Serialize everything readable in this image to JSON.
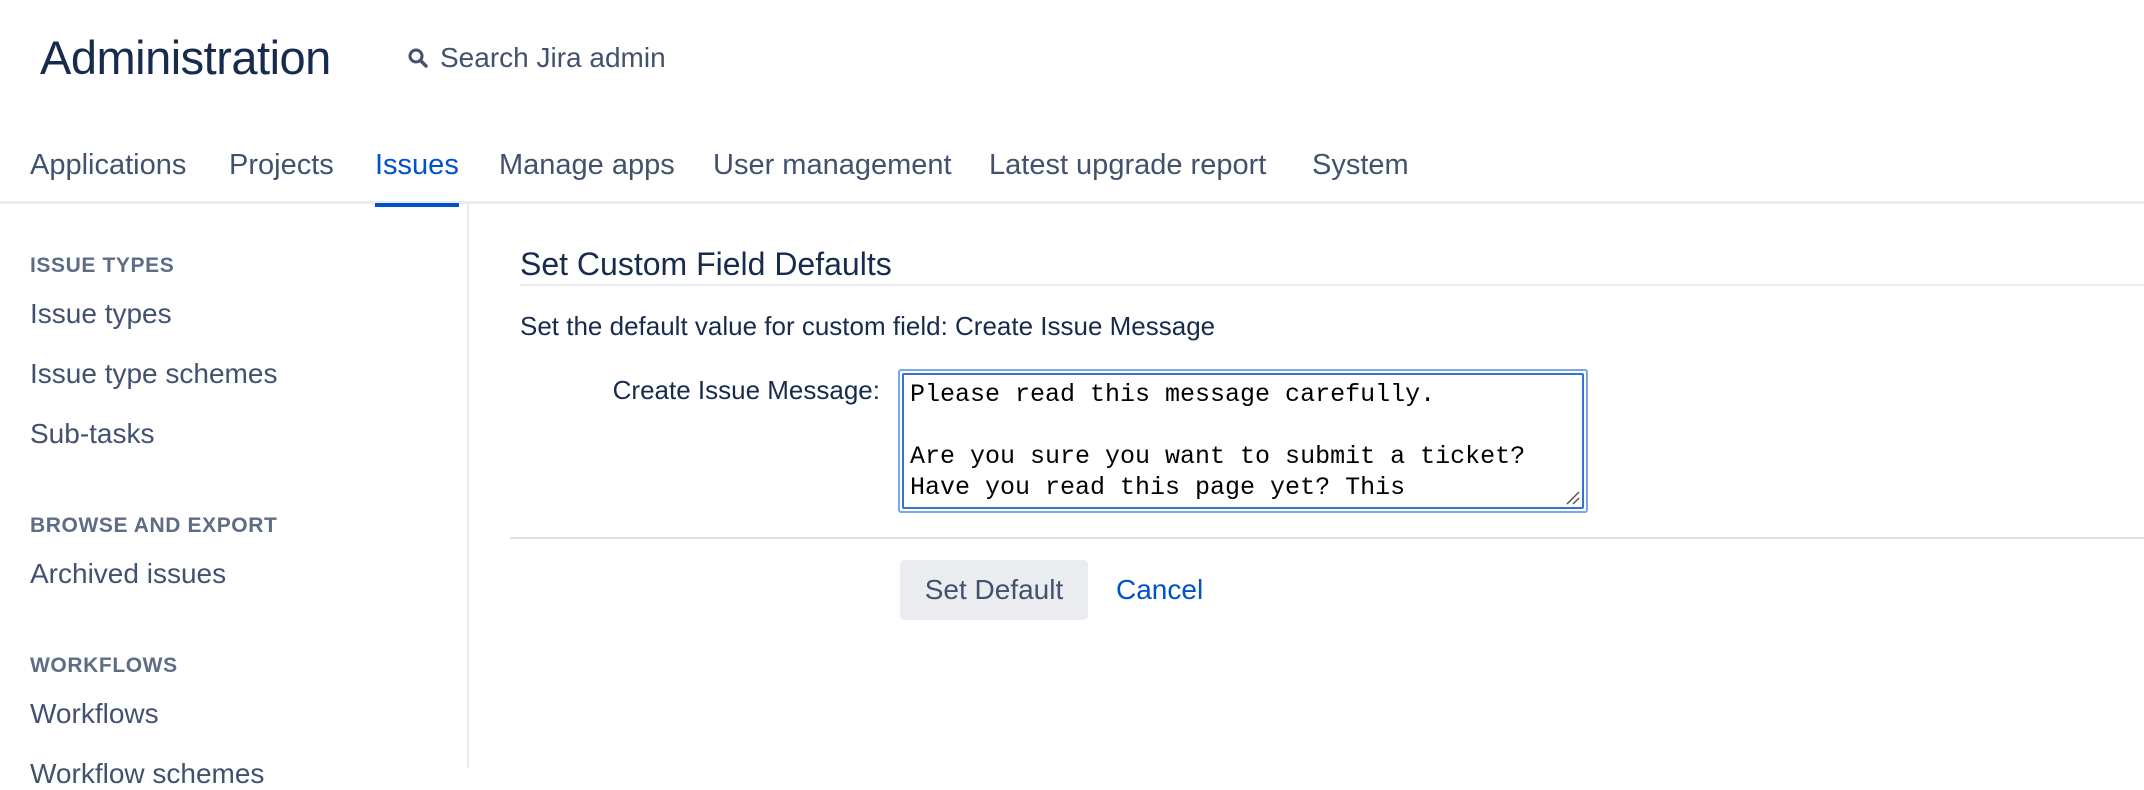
{
  "header": {
    "title": "Administration",
    "search_label": "Search Jira admin"
  },
  "nav": {
    "tabs": [
      {
        "label": "Applications"
      },
      {
        "label": "Projects"
      },
      {
        "label": "Issues",
        "active": true
      },
      {
        "label": "Manage apps"
      },
      {
        "label": "User management"
      },
      {
        "label": "Latest upgrade report"
      },
      {
        "label": "System"
      }
    ]
  },
  "sidebar": {
    "sections": [
      {
        "heading": "ISSUE TYPES",
        "items": [
          "Issue types",
          "Issue type schemes",
          "Sub-tasks"
        ]
      },
      {
        "heading": "BROWSE AND EXPORT",
        "items": [
          "Archived issues"
        ]
      },
      {
        "heading": "WORKFLOWS",
        "items": [
          "Workflows",
          "Workflow schemes"
        ]
      }
    ]
  },
  "main": {
    "heading": "Set Custom Field Defaults",
    "description": "Set the default value for custom field: Create Issue Message",
    "field_label": "Create Issue Message:",
    "field_value": "Please read this message carefully.\n\nAre you sure you want to submit a ticket?\nHave you read this page yet? This",
    "set_default_label": "Set Default",
    "cancel_label": "Cancel"
  },
  "colors": {
    "accent": "#0052cc",
    "text": "#172b4d",
    "muted": "#42526e",
    "focus_border": "#3572d6"
  }
}
